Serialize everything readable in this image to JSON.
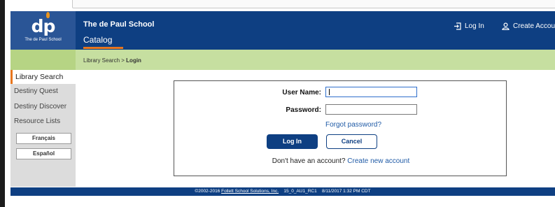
{
  "header": {
    "logo_mark": "dp",
    "logo_tag": "The de Paul School",
    "school_name": "The de Paul School",
    "tab_catalog": "Catalog",
    "login_label": "Log In",
    "account_label": "Create Account"
  },
  "breadcrumb": {
    "parent": "Library Search",
    "separator": ">",
    "current": "Login"
  },
  "sidebar": {
    "items": [
      {
        "label": "Library Search"
      },
      {
        "label": "Destiny Quest"
      },
      {
        "label": "Destiny Discover"
      },
      {
        "label": "Resource Lists"
      }
    ],
    "languages": [
      {
        "label": "Français"
      },
      {
        "label": "Español"
      }
    ]
  },
  "login_form": {
    "username_label": "User Name:",
    "username_value": "",
    "password_label": "Password:",
    "password_value": "",
    "forgot_link": "Forgot password?",
    "login_button": "Log In",
    "cancel_button": "Cancel",
    "no_account_text": "Don't have an account?",
    "create_link": "Create new account"
  },
  "footer": {
    "copyright": "©2002-2016",
    "company_link": "Follett School Solutions, Inc.",
    "version": "15_0_AU1_RC1",
    "timestamp": "8/11/2017 1:32 PM CDT"
  },
  "colors": {
    "header_bg": "#0e3f82",
    "accent": "#e8761e",
    "crumb_bg": "#c6dfa0",
    "link": "#1f5aa6"
  }
}
